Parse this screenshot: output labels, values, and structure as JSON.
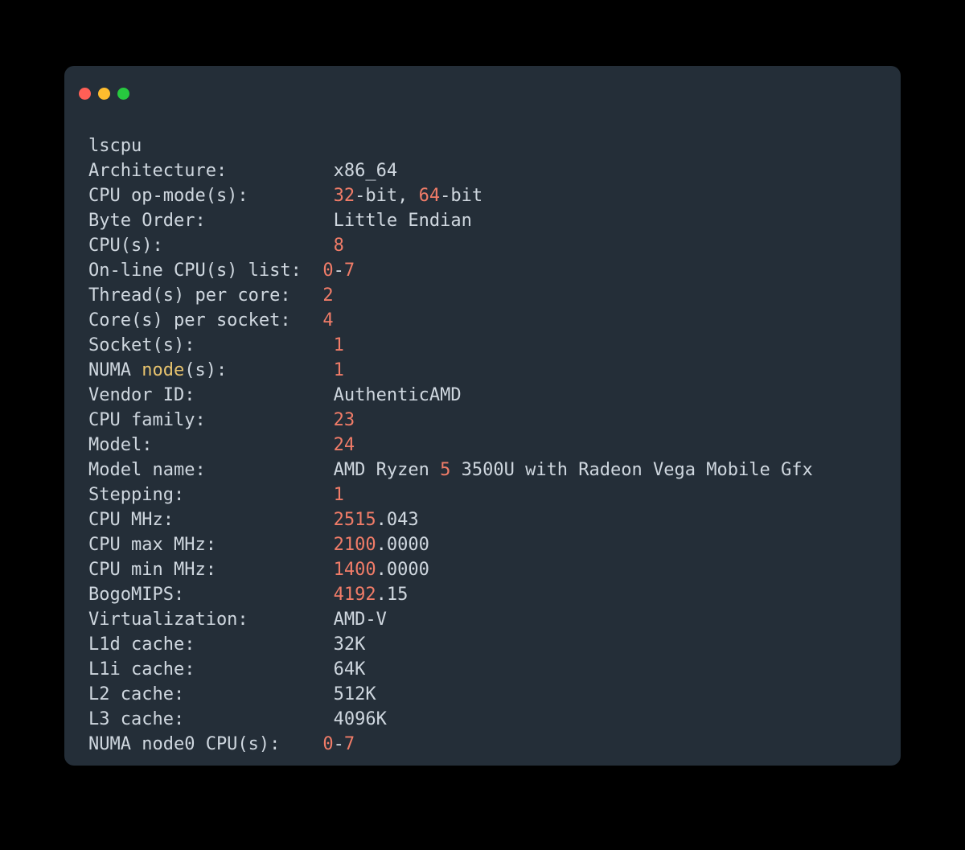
{
  "command": "lscpu",
  "labels": {
    "architecture": "Architecture:",
    "cpu_op_modes": "CPU op-mode(s):",
    "byte_order": "Byte Order:",
    "cpus": "CPU(s):",
    "online_cpus": "On-line CPU(s) list:",
    "threads_per_core": "Thread(s) per core:",
    "cores_per_socket": "Core(s) per socket:",
    "sockets": "Socket(s):",
    "numa_nodes_prefix": "NUMA ",
    "numa_nodes_kw": "node",
    "numa_nodes_suffix": "(s):",
    "vendor_id": "Vendor ID:",
    "cpu_family": "CPU family:",
    "model": "Model:",
    "model_name": "Model name:",
    "stepping": "Stepping:",
    "cpu_mhz": "CPU MHz:",
    "cpu_max_mhz": "CPU max MHz:",
    "cpu_min_mhz": "CPU min MHz:",
    "bogomips": "BogoMIPS:",
    "virtualization": "Virtualization:",
    "l1d": "L1d cache:",
    "l1i": "L1i cache:",
    "l2": "L2 cache:",
    "l3": "L3 cache:",
    "numa_node0": "NUMA node0 CPU(s):"
  },
  "values": {
    "architecture": "x86_64",
    "op_mode_32": "32",
    "op_mode_mid1": "-bit, ",
    "op_mode_64": "64",
    "op_mode_mid2": "-bit",
    "byte_order": "Little Endian",
    "cpus": "8",
    "online_cpus_a": "0",
    "dash": "-",
    "online_cpus_b": "7",
    "threads_per_core": "2",
    "cores_per_socket": "4",
    "sockets": "1",
    "numa_nodes": "1",
    "vendor_id": "AuthenticAMD",
    "cpu_family": "23",
    "model": "24",
    "model_name_a": "AMD Ryzen ",
    "model_name_num": "5",
    "model_name_b": " 3500U with Radeon Vega Mobile Gfx",
    "stepping": "1",
    "cpu_mhz_num": "2515",
    "cpu_mhz_rest": ".043",
    "cpu_max_mhz_num": "2100",
    "cpu_max_mhz_rest": ".0000",
    "cpu_min_mhz_num": "1400",
    "cpu_min_mhz_rest": ".0000",
    "bogomips_num": "4192",
    "bogomips_rest": ".15",
    "virtualization": "AMD-V",
    "l1d": "32K",
    "l1i": "64K",
    "l2": "512K",
    "l3": "4096K",
    "numa_node0_a": "0",
    "numa_node0_b": "7"
  }
}
